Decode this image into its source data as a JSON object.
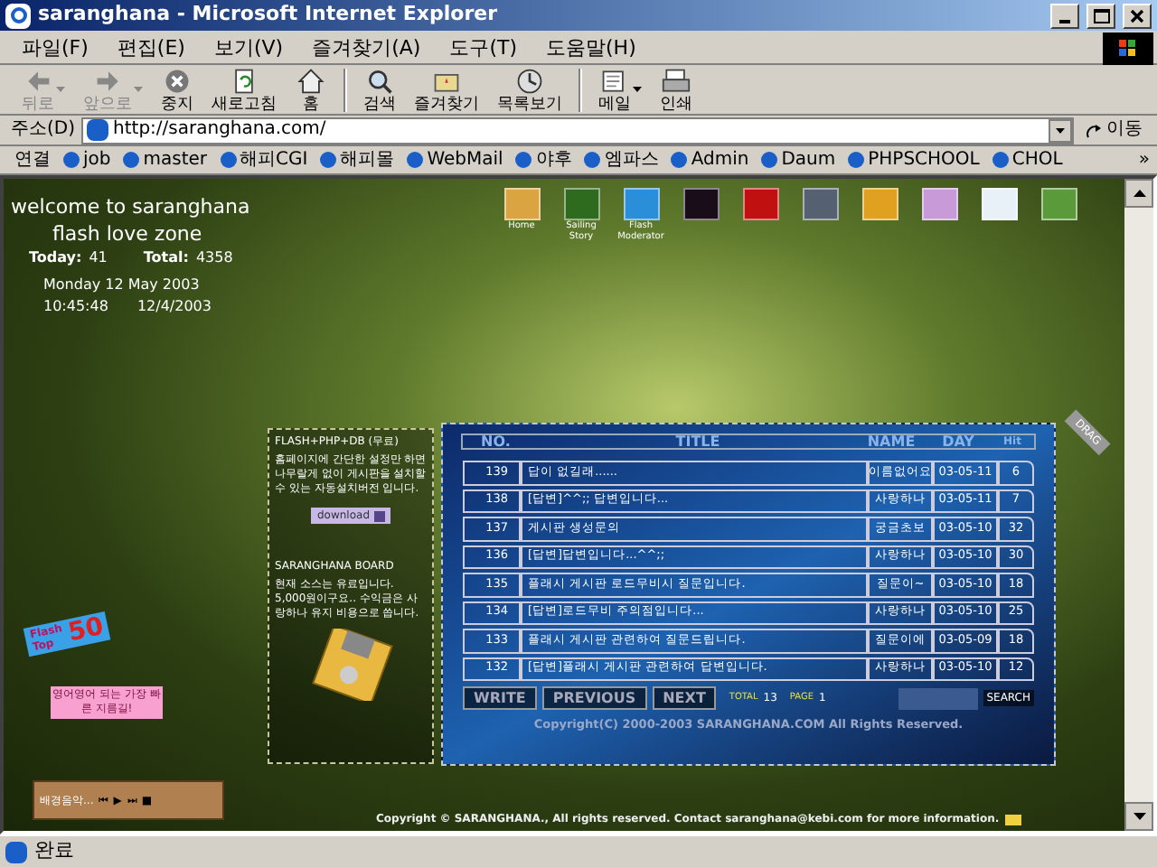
{
  "window": {
    "title": "saranghana - Microsoft Internet Explorer"
  },
  "menu": [
    "파일(F)",
    "편집(E)",
    "보기(V)",
    "즐겨찾기(A)",
    "도구(T)",
    "도움말(H)"
  ],
  "toolbar": [
    {
      "kind": "back",
      "label": "뒤로",
      "disabled": true,
      "dropdown": true
    },
    {
      "kind": "forward",
      "label": "앞으로",
      "disabled": true,
      "dropdown": true
    },
    {
      "kind": "stop",
      "label": "중지",
      "disabled": false,
      "dropdown": false
    },
    {
      "kind": "refresh",
      "label": "새로고침",
      "disabled": false,
      "dropdown": false
    },
    {
      "kind": "home",
      "label": "홈",
      "disabled": false,
      "dropdown": false
    },
    {
      "kind": "search",
      "label": "검색",
      "disabled": false,
      "dropdown": false
    },
    {
      "kind": "favorites",
      "label": "즐겨찾기",
      "disabled": false,
      "dropdown": false
    },
    {
      "kind": "history",
      "label": "목록보기",
      "disabled": false,
      "dropdown": false
    },
    {
      "kind": "mail",
      "label": "메일",
      "disabled": false,
      "dropdown": true
    },
    {
      "kind": "print",
      "label": "인쇄",
      "disabled": false,
      "dropdown": false
    }
  ],
  "address": {
    "label": "주소(D)",
    "url": "http://saranghana.com/",
    "go": "이동"
  },
  "links": {
    "label": "연결",
    "items": [
      "job",
      "master",
      "해피CGI",
      "해피몰",
      "WebMail",
      "야후",
      "엠파스",
      "Admin",
      "Daum",
      "PHPSCHOOL",
      "CHOL"
    ],
    "more": "»"
  },
  "page": {
    "welcome": [
      "welcome to saranghana",
      "flash love zone"
    ],
    "counter": {
      "today_label": "Today:",
      "today": "41",
      "total_label": "Total:",
      "total": "4358"
    },
    "date": "Monday 12 May 2003",
    "time": "10:45:48",
    "date2": "12/4/2003",
    "icons": [
      {
        "label": "Home",
        "color": "#d9a441"
      },
      {
        "label": "Sailing Story",
        "color": "#2f6b1f"
      },
      {
        "label": "Flash Moderator",
        "color": "#2a8fd8"
      },
      {
        "color": "#1a0d1a"
      },
      {
        "color": "#c01010"
      },
      {
        "color": "#556070"
      },
      {
        "color": "#e0a020"
      },
      {
        "color": "#c89ad8"
      },
      {
        "color": "#e8f0f8"
      },
      {
        "color": "#5a9a3a"
      }
    ],
    "info": {
      "title1": "FLASH+PHP+DB (무료)",
      "text1": "홈페이지에 간단한 설정만 하면 나무랄게 없이 게시판을 설치할 수 있는 자동설치버전 입니다.",
      "download": "download",
      "title2": "SARANGHANA BOARD",
      "text2": "현재 소스는 유료입니다. 5,000원이구요.. 수익금은 사랑하나 유지 비용으로 씁니다."
    },
    "badge": {
      "top": "Flash Top",
      "num": "50"
    },
    "sign": "영어영어 되는 가장 빠른 지름길!",
    "player": {
      "label": "배경음악...",
      "controls": [
        "⏮",
        "▶",
        "⏭",
        "■"
      ]
    },
    "board": {
      "drag": "DRAG",
      "columns": [
        "NO.",
        "TITLE",
        "NAME",
        "DAY",
        "Hit"
      ],
      "rows": [
        {
          "no": "139",
          "title": "답이 없길래......",
          "name": "이름없어요",
          "day": "03-05-11",
          "hit": "6"
        },
        {
          "no": "138",
          "title": "[답변]^^;; 답변입니다...",
          "name": "사랑하나",
          "day": "03-05-11",
          "hit": "7"
        },
        {
          "no": "137",
          "title": "게시판 생성문의",
          "name": "궁금초보",
          "day": "03-05-10",
          "hit": "32"
        },
        {
          "no": "136",
          "title": "[답변]답변입니다...^^;;",
          "name": "사랑하나",
          "day": "03-05-10",
          "hit": "30"
        },
        {
          "no": "135",
          "title": "플래시 게시판 로드무비시 질문입니다.",
          "name": "질문이~",
          "day": "03-05-10",
          "hit": "18"
        },
        {
          "no": "134",
          "title": "[답변]로드무비 주의점입니다...",
          "name": "사랑하나",
          "day": "03-05-10",
          "hit": "25"
        },
        {
          "no": "133",
          "title": "플래시 게시판 관련하여 질문드립니다.",
          "name": "질문이에",
          "day": "03-05-09",
          "hit": "18"
        },
        {
          "no": "132",
          "title": "[답변]플래시 게시판 관련하여 답변입니다.",
          "name": "사랑하나",
          "day": "03-05-10",
          "hit": "12"
        }
      ],
      "buttons": [
        "WRITE",
        "PREVIOUS",
        "NEXT"
      ],
      "total_label": "TOTAL",
      "total": "13",
      "page_label": "PAGE",
      "page": "1",
      "search": "SEARCH",
      "copyright": "Copyright(C) 2000-2003 SARANGHANA.COM All Rights Reserved."
    },
    "footer": "Copyright © SARANGHANA., All rights reserved. Contact  saranghana@kebi.com for more information."
  },
  "status": "완료"
}
